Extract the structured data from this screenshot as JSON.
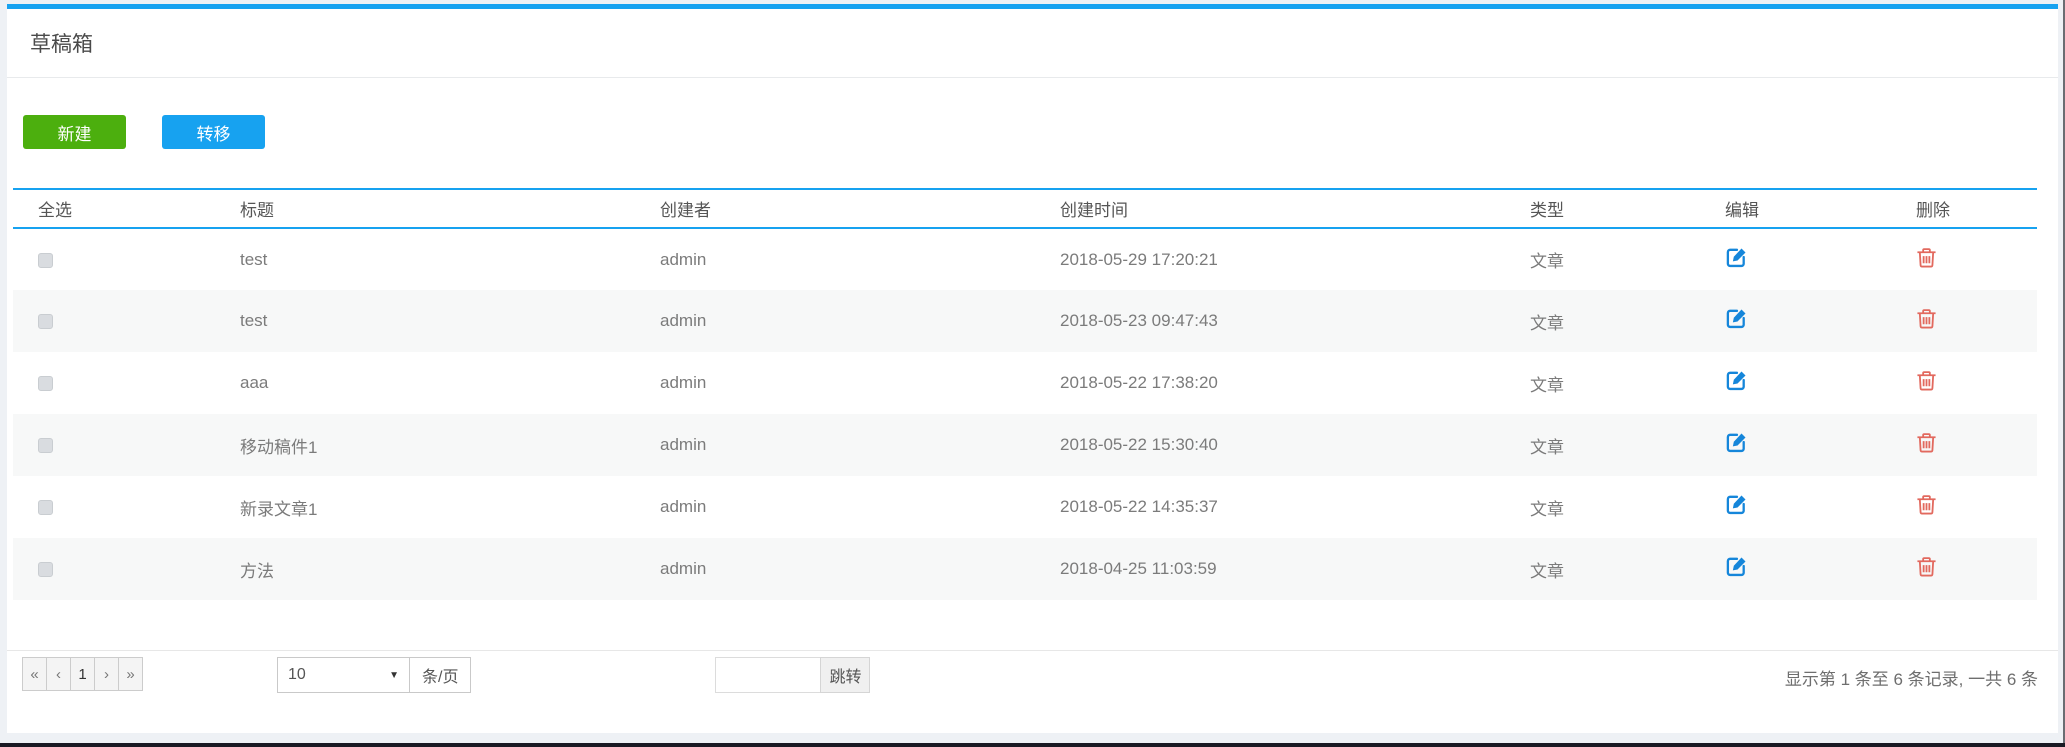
{
  "page": {
    "title": "草稿箱"
  },
  "toolbar": {
    "new_label": "新建",
    "transfer_label": "转移"
  },
  "table": {
    "headers": [
      "全选",
      "标题",
      "创建者",
      "创建时间",
      "类型",
      "编辑",
      "删除"
    ],
    "rows": [
      {
        "title": "test",
        "creator": "admin",
        "created_at": "2018-05-29 17:20:21",
        "type": "文章"
      },
      {
        "title": "test",
        "creator": "admin",
        "created_at": "2018-05-23 09:47:43",
        "type": "文章"
      },
      {
        "title": "aaa",
        "creator": "admin",
        "created_at": "2018-05-22 17:38:20",
        "type": "文章"
      },
      {
        "title": "移动稿件1",
        "creator": "admin",
        "created_at": "2018-05-22 15:30:40",
        "type": "文章"
      },
      {
        "title": "新录文章1",
        "creator": "admin",
        "created_at": "2018-05-22 14:35:37",
        "type": "文章"
      },
      {
        "title": "方法",
        "creator": "admin",
        "created_at": "2018-04-25 11:03:59",
        "type": "文章"
      }
    ]
  },
  "pagination": {
    "first_label": "«",
    "prev_label": "‹",
    "current_page": "1",
    "next_label": "›",
    "last_label": "»",
    "page_size": "10",
    "caret": "▼",
    "per_page_label": "条/页",
    "jump_value": "",
    "jump_label": "跳转",
    "summary": "显示第 1 条至 6 条记录, 一共 6 条"
  },
  "icons": {
    "edit": "edit-pencil-square-icon",
    "delete": "trash-icon"
  },
  "colors": {
    "accent_blue": "#17a2f0",
    "button_green": "#4caf0e",
    "edit_blue": "#1586da",
    "delete_red": "#e2695e"
  }
}
